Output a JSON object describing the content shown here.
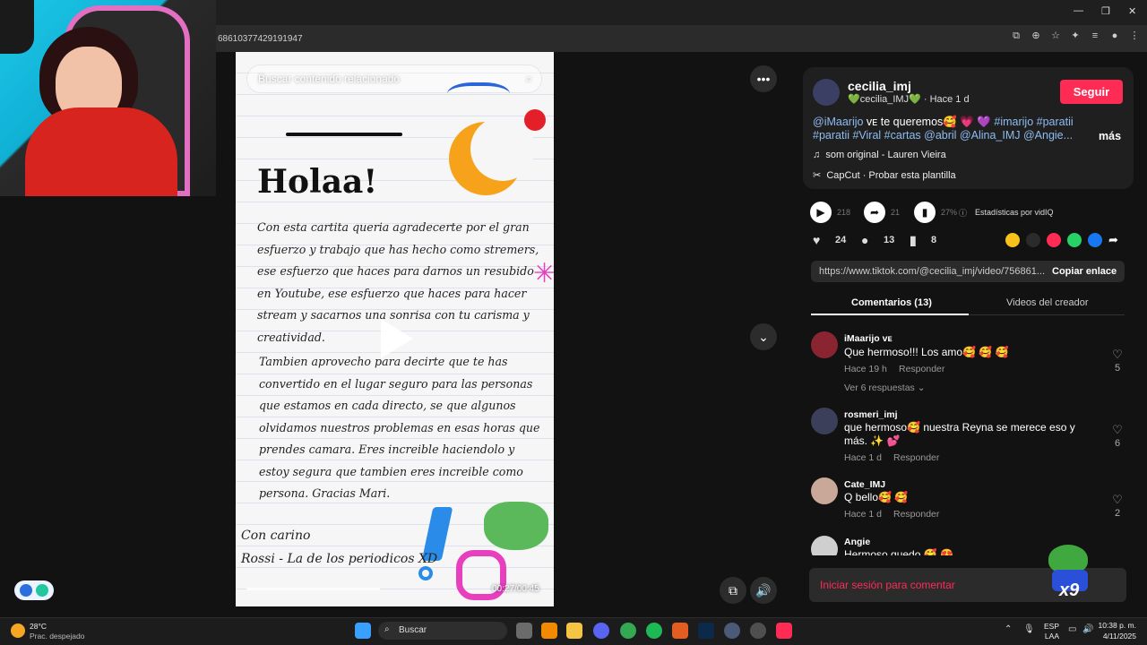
{
  "browser": {
    "url_fragment": "6861037742919194",
    "url_suffix": "7"
  },
  "video": {
    "search_placeholder": "Buscar contenido relacionado",
    "title": "Holaa!",
    "body1": "Con esta cartita queria agradecerte por el gran esfuerzo y trabajo que has hecho como stremers, ese esfuerzo que haces para darnos un resubido en Youtube, ese esfuerzo que haces para hacer stream y sacarnos una sonrisa con tu carisma y creatividad.",
    "body2": "Tambien aprovecho para decirte que te has convertido en el lugar seguro para las personas que estamos en cada directo, se que algunos olvidamos nuestros problemas en esas horas que prendes camara. Eres increible haciendolo y estoy segura que tambien eres increible como persona. Gracias Mari.",
    "sign1": "Con carino",
    "sign2": "Rossi - La de los periodicos XD",
    "time": "00:27/00:45",
    "progress": 0.45
  },
  "post": {
    "username": "cecilia_imj",
    "sub_name": "💚cecilia_IMJ💚",
    "sub_time": " · Hace 1 d",
    "follow": "Seguir",
    "caption_a": "@iMaarijo",
    "caption_a_badge": " ᴠᴇ",
    "caption_b": " te queremos🥰 💗 💜 ",
    "caption_c": "#imarijo #paratii #paratii #Viral #cartas @abril @Alina_IMJ @Angie...",
    "more": "más",
    "sound": "som original - Lauren Vieira",
    "capcut": "CapCut · Probar esta plantilla",
    "stat_play": "218",
    "stat_share": "21",
    "stat_pct": "27%",
    "vidiq": "Estadísticas por vidIQ",
    "likes": "24",
    "comments": "13",
    "saves": "8",
    "url": "https://www.tiktok.com/@cecilia_imj/video/756861...",
    "copy": "Copiar enlace",
    "tab_comments": "Comentarios (13)",
    "tab_videos": "Videos del creador",
    "login": "Iniciar sesión para comentar"
  },
  "comments": [
    {
      "name": "iMaarijo ᴠᴇ",
      "text": "Que hermoso!!! Los amo🥰 🥰 🥰",
      "time": "Hace 19 h",
      "reply": "Responder",
      "likes": "5",
      "more": "Ver 6 respuestas ⌄"
    },
    {
      "name": "rosmeri_imj",
      "text": "que hermoso🥰 nuestra Reyna se merece eso y más. ✨ 💕",
      "time": "Hace 1 d",
      "reply": "Responder",
      "likes": "6"
    },
    {
      "name": "Cate_IMJ",
      "text": "Q bello🥰 🥰",
      "time": "Hace 1 d",
      "reply": "Responder",
      "likes": "2"
    },
    {
      "name": "Angie",
      "text": "Hermoso quedo 🥰 😍"
    }
  ],
  "taskbar": {
    "temp": "28°C",
    "weather": "Prac. despejado",
    "search": "Buscar",
    "lang1": "ESP",
    "lang2": "LAA",
    "time": "10:38 p. m.",
    "date": "4/11/2025"
  },
  "sticker_text": "x9"
}
